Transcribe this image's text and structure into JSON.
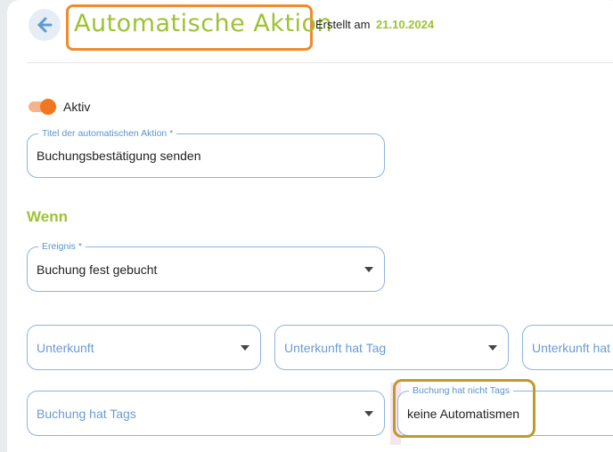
{
  "header": {
    "back_icon": "arrow-left-icon",
    "title": "Automatische Aktion",
    "created_label": "Erstellt am",
    "created_date": "21.10.2024"
  },
  "toggle": {
    "label": "Aktiv",
    "on": true
  },
  "fields": {
    "title": {
      "legend": "Titel der automatischen Aktion *",
      "value": "Buchungsbestätigung senden"
    },
    "event": {
      "legend": "Ereignis *",
      "value": "Buchung fest gebucht"
    },
    "accommodation": {
      "placeholder": "Unterkunft"
    },
    "accommodation_tag": {
      "placeholder": "Unterkunft hat Tag"
    },
    "accommodation_tag_extra": {
      "placeholder": "Unterkunft hat"
    },
    "booking_tags": {
      "placeholder": "Buchung hat Tags"
    },
    "booking_not_tags": {
      "legend": "Buchung hat nicht Tags",
      "value": "keine Automatismen"
    }
  },
  "sections": {
    "when": "Wenn"
  },
  "colors": {
    "accent_green": "#9ec233",
    "accent_orange": "#f2761f",
    "field_border": "#8db3e2"
  }
}
